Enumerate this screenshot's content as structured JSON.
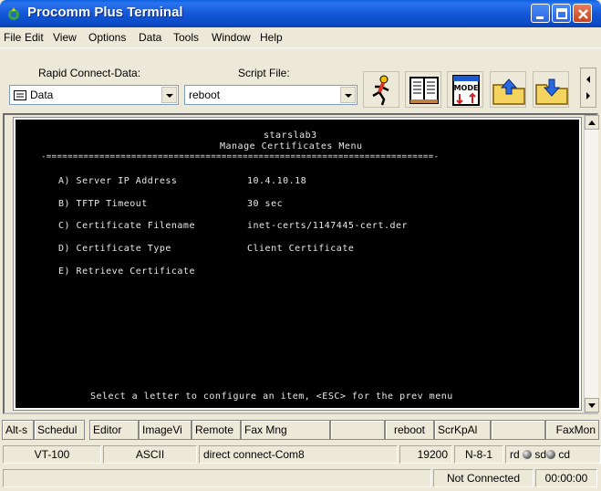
{
  "window": {
    "title": "Procomm Plus Terminal"
  },
  "menu": [
    "File",
    "Edit",
    "View",
    "Options",
    "Data",
    "Tools",
    "Window",
    "Help"
  ],
  "toolbar": {
    "rapid_connect_label": "Rapid Connect-Data:",
    "rapid_connect_value": "Data",
    "script_file_label": "Script File:",
    "script_file_value": "reboot",
    "icons": [
      "run-script-icon",
      "phonebook-icon",
      "mode-icon",
      "send-file-icon",
      "receive-file-icon"
    ],
    "mode_text": "MODE"
  },
  "terminal": {
    "host": "starslab3",
    "menu_title": "Manage Certificates Menu",
    "separator": "-=========================================================================-",
    "items": [
      {
        "key": "A) Server IP Address",
        "value": "10.4.10.18"
      },
      {
        "key": "B) TFTP Timeout",
        "value": "30 sec"
      },
      {
        "key": "C) Certificate Filename",
        "value": "inet-certs/1147445-cert.der"
      },
      {
        "key": "D) Certificate Type",
        "value": "Client Certificate"
      },
      {
        "key": "E) Retrieve Certificate",
        "value": ""
      }
    ],
    "prompt": "Select a letter to configure an item, <ESC> for the prev menu"
  },
  "action_bar": [
    "Alt-s",
    "Schedul",
    "Editor",
    "ImageVi",
    "Remote",
    "Fax Mng",
    "",
    "reboot",
    "ScrKpAl",
    "",
    "FaxMon"
  ],
  "status": {
    "emulation": "VT-100",
    "transfer": "ASCII",
    "connection": "direct connect-Com8",
    "baud": "19200",
    "params": "N-8-1",
    "rd": "rd",
    "sd": "sd",
    "cd": "cd",
    "state": "Not Connected",
    "timer": "00:00:00"
  },
  "colors": {
    "title_blue": "#1457d8",
    "terminal_bg": "#000000",
    "terminal_fg": "#e8e8e8"
  }
}
